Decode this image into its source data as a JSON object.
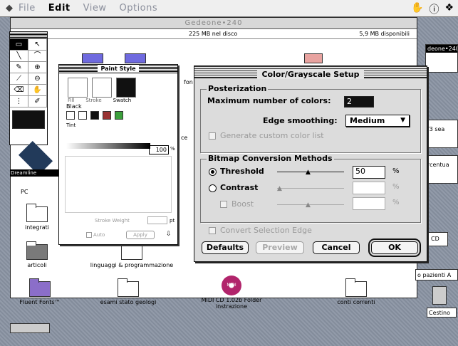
{
  "menubar": {
    "items": [
      "File",
      "Edit",
      "View",
      "Options"
    ]
  },
  "finder": {
    "title": "Gedeone•240",
    "disk_used": "225 MB nel disco",
    "disk_free": "5,9 MB disponibili",
    "left_info": "ti",
    "icons": [
      {
        "label": "integrati"
      },
      {
        "label": "articoli"
      },
      {
        "label": "linguaggi & programmazione"
      },
      {
        "label": "Fluent Fonts™"
      },
      {
        "label": "esami stato geologi"
      },
      {
        "label": "MIDI CD 1.02b Folder instrazione"
      },
      {
        "label": "conti correnti"
      },
      {
        "label": "PC"
      },
      {
        "label": "fon"
      },
      {
        "label": "ce"
      }
    ]
  },
  "side_windows": {
    "top_label": "deone•240",
    "mid_label": "/3 sea",
    "mid2_label": "rcentua",
    "cd_label": "CD",
    "pazienti_label": "o pazienti A",
    "cestino_label": "Cestino"
  },
  "tools": {
    "title": "",
    "buttons": [
      "▭",
      "↖",
      "╲",
      "⌒",
      "✎",
      "⊕",
      "⟋",
      "⊖",
      "⌫",
      "✋",
      "⋮",
      "✐"
    ]
  },
  "paint_style": {
    "title": "Paint Style",
    "fill_label": "Fill",
    "stroke_label": "Stroke",
    "swatch_label": "Swatch",
    "black_label": "Black",
    "tint_label": "Tint",
    "tint_value": "100",
    "percent": "%",
    "stroke_weight_label": "Stroke Weight",
    "pt_label": "pt",
    "auto_label": "Auto",
    "apply_label": "Apply",
    "dreamline_label": "Dreamline"
  },
  "dialog": {
    "title": "Color/Grayscale Setup",
    "posterization_label": "Posterization",
    "max_colors_label": "Maximum number of colors:",
    "max_colors_value": "2",
    "edge_smoothing_label": "Edge smoothing:",
    "edge_smoothing_value": "Medium",
    "custom_color_label": "Generate custom color list",
    "bitmap_label": "Bitmap Conversion Methods",
    "threshold_label": "Threshold",
    "threshold_value": "50",
    "contrast_label": "Contrast",
    "boost_label": "Boost",
    "percent": "%",
    "convert_label": "Convert Selection Edge",
    "defaults_label": "Defaults",
    "preview_label": "Preview",
    "cancel_label": "Cancel",
    "ok_label": "OK"
  }
}
